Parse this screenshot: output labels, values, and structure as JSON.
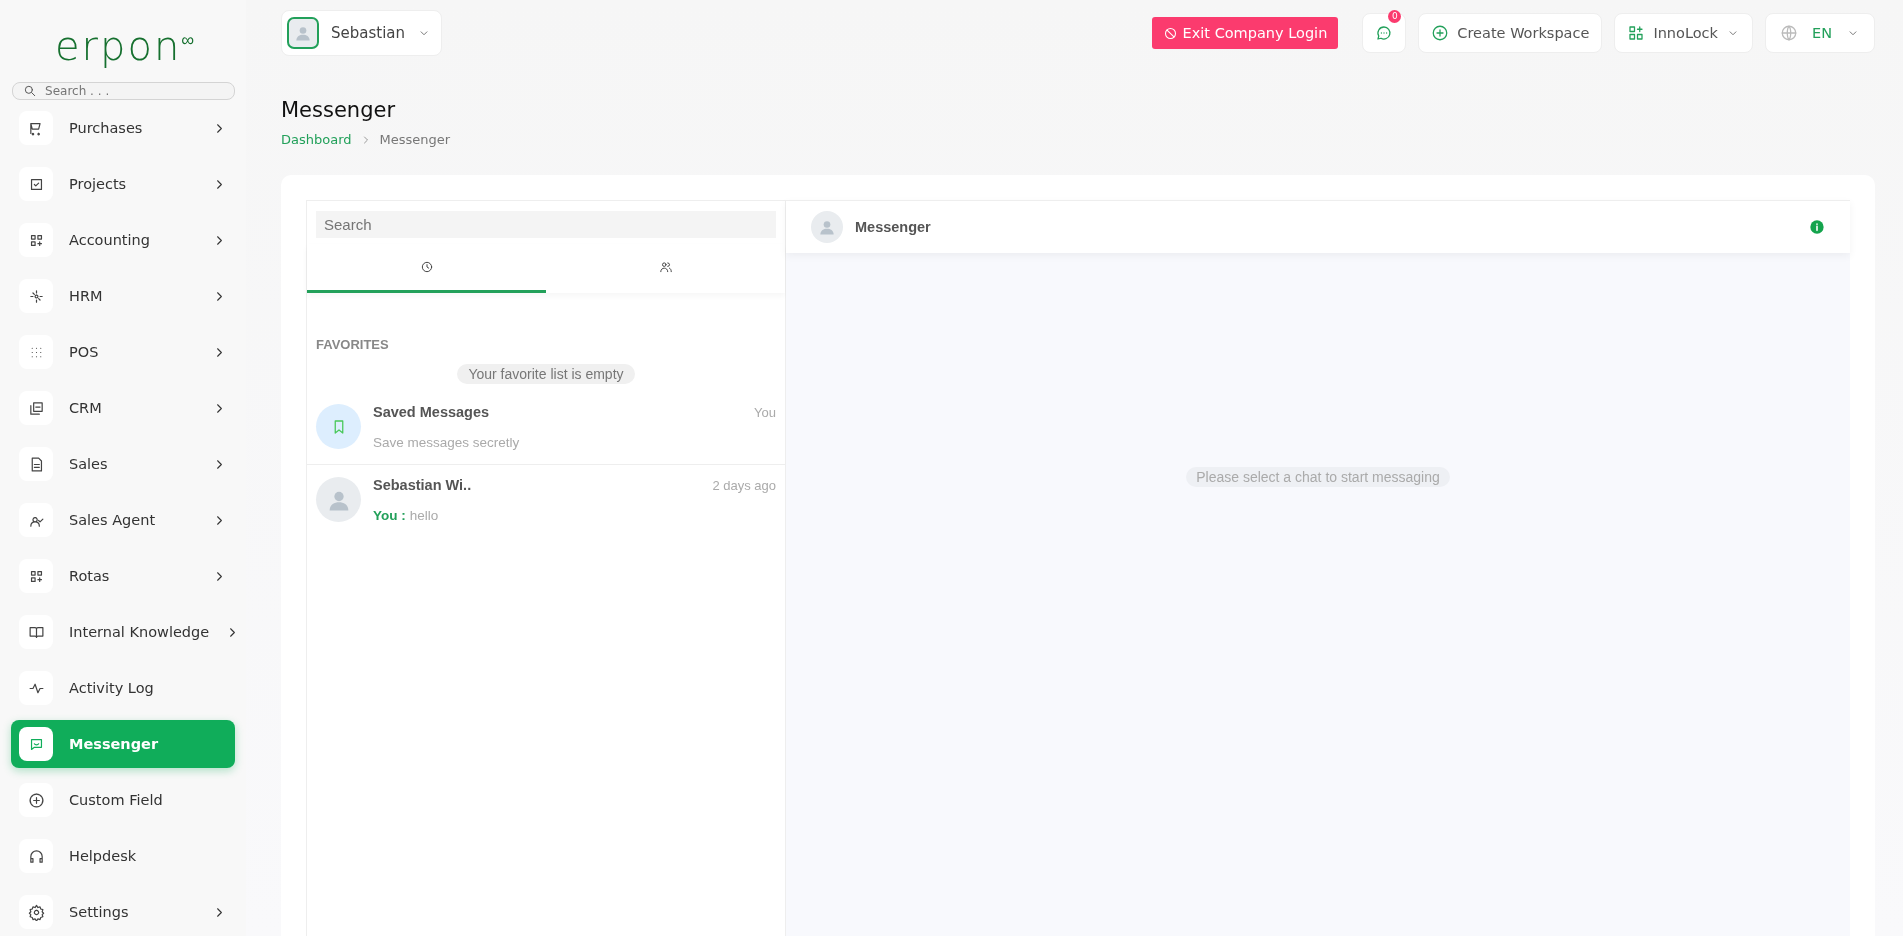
{
  "logo": {
    "text": "erpon",
    "mark": "∞"
  },
  "sidebar": {
    "search": {
      "placeholder": "Search . . ."
    },
    "items": [
      {
        "label": "Purchases",
        "has_submenu": true,
        "selected": false
      },
      {
        "label": "Projects",
        "has_submenu": true,
        "selected": false
      },
      {
        "label": "Accounting",
        "has_submenu": true,
        "selected": false
      },
      {
        "label": "HRM",
        "has_submenu": true,
        "selected": false
      },
      {
        "label": "POS",
        "has_submenu": true,
        "selected": false
      },
      {
        "label": "CRM",
        "has_submenu": true,
        "selected": false
      },
      {
        "label": "Sales",
        "has_submenu": true,
        "selected": false
      },
      {
        "label": "Sales Agent",
        "has_submenu": true,
        "selected": false
      },
      {
        "label": "Rotas",
        "has_submenu": true,
        "selected": false
      },
      {
        "label": "Internal Knowledge",
        "has_submenu": true,
        "selected": false
      },
      {
        "label": "Activity Log",
        "has_submenu": false,
        "selected": false
      },
      {
        "label": "Messenger",
        "has_submenu": false,
        "selected": true
      },
      {
        "label": "Custom Field",
        "has_submenu": false,
        "selected": false
      },
      {
        "label": "Helpdesk",
        "has_submenu": false,
        "selected": false
      },
      {
        "label": "Settings",
        "has_submenu": true,
        "selected": false
      }
    ]
  },
  "topbar": {
    "user": "Sebastian",
    "exit_button": "Exit Company Login",
    "notification_count": "0",
    "create_workspace": "Create Workspace",
    "workspace": "InnoLock",
    "language": "EN"
  },
  "page": {
    "title": "Messenger",
    "breadcrumb": [
      "Dashboard",
      "Messenger"
    ]
  },
  "chat_list": {
    "search": {
      "placeholder": "Search"
    },
    "tabs": [
      {
        "selected": true
      },
      {
        "selected": false
      }
    ],
    "favorites_heading": "FAVORITES",
    "favorites_empty": "Your favorite list is empty",
    "chats": [
      {
        "kind": "saved",
        "name": "Saved Messages",
        "time": "You",
        "preview": "Save messages secretly"
      },
      {
        "kind": "person",
        "name": "Sebastian Wi..",
        "time": "2 days ago",
        "sender": "You :",
        "preview": "hello"
      }
    ]
  },
  "chat_view": {
    "title": "Messenger",
    "empty_text": "Please select a chat to start messaging"
  }
}
